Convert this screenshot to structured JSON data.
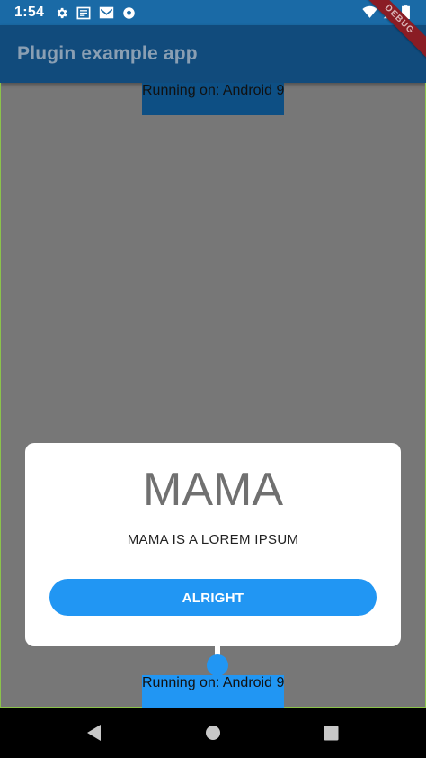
{
  "status_bar": {
    "time": "1:54",
    "icons": [
      "gear-icon",
      "news-icon",
      "mail-icon",
      "soccer-ball-icon"
    ],
    "right_icons": [
      "wifi-icon",
      "signal-icon",
      "battery-icon"
    ]
  },
  "app_bar": {
    "title": "Plugin example app"
  },
  "debug_banner": "DEBUG",
  "body": {
    "running_top": "Running on: Android 9",
    "running_bottom": "Running on: Android 9"
  },
  "dialog": {
    "title": "MAMA",
    "message": "MAMA IS A LOREM IPSUM",
    "button_label": "ALRIGHT"
  },
  "nav_bar": {
    "icons": [
      "back-icon",
      "home-icon",
      "recent-apps-icon"
    ]
  },
  "colors": {
    "status_bar": "#1a6aa6",
    "app_bar": "#114b7c",
    "scrim": "#777777",
    "accent": "#2196f3"
  }
}
